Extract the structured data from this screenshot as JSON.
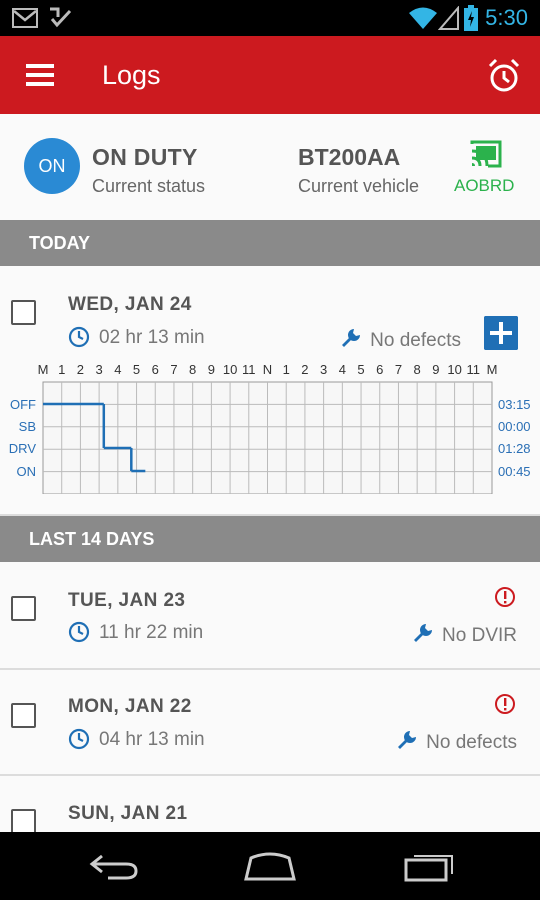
{
  "status_bar": {
    "time": "5:30",
    "icons": [
      "gmail-icon",
      "download-check-icon",
      "wifi-icon",
      "signal-icon",
      "battery-charging-icon"
    ]
  },
  "app_bar": {
    "title": "Logs",
    "menu_icon": "menu-icon",
    "alarm_icon": "alarm-clock-icon"
  },
  "status": {
    "badge": "ON",
    "title": "ON DUTY",
    "subtitle": "Current status",
    "vehicle": "BT200AA",
    "vehicle_subtitle": "Current vehicle",
    "mode": "AOBRD",
    "accent": "#cc1a1f",
    "badge_color": "#2a8ad4",
    "mode_color": "#2bb24c"
  },
  "sections": {
    "today": "TODAY",
    "last14": "LAST 14 DAYS"
  },
  "today": {
    "date": "WED, JAN 24",
    "duration": "02 hr  13 min",
    "defects": "No defects",
    "graph": {
      "hour_labels": [
        "M",
        "1",
        "2",
        "3",
        "4",
        "5",
        "6",
        "7",
        "8",
        "9",
        "10",
        "11",
        "N",
        "1",
        "2",
        "3",
        "4",
        "5",
        "6",
        "7",
        "8",
        "9",
        "10",
        "11",
        "M"
      ],
      "rows": [
        "OFF",
        "SB",
        "DRV",
        "ON"
      ],
      "totals": [
        "03:15",
        "00:00",
        "01:28",
        "00:45"
      ],
      "segments": [
        {
          "status": "OFF",
          "start": 0,
          "end": 3.25
        },
        {
          "status": "DRV",
          "start": 3.25,
          "end": 4.72
        },
        {
          "status": "ON",
          "start": 4.72,
          "end": 5.47
        }
      ]
    }
  },
  "history": [
    {
      "date": "TUE, JAN 23",
      "duration": "11 hr  22 min",
      "defects": "No DVIR",
      "warning": true
    },
    {
      "date": "MON, JAN 22",
      "duration": "04 hr  13 min",
      "defects": "No defects",
      "warning": true
    },
    {
      "date": "SUN, JAN 21"
    }
  ]
}
